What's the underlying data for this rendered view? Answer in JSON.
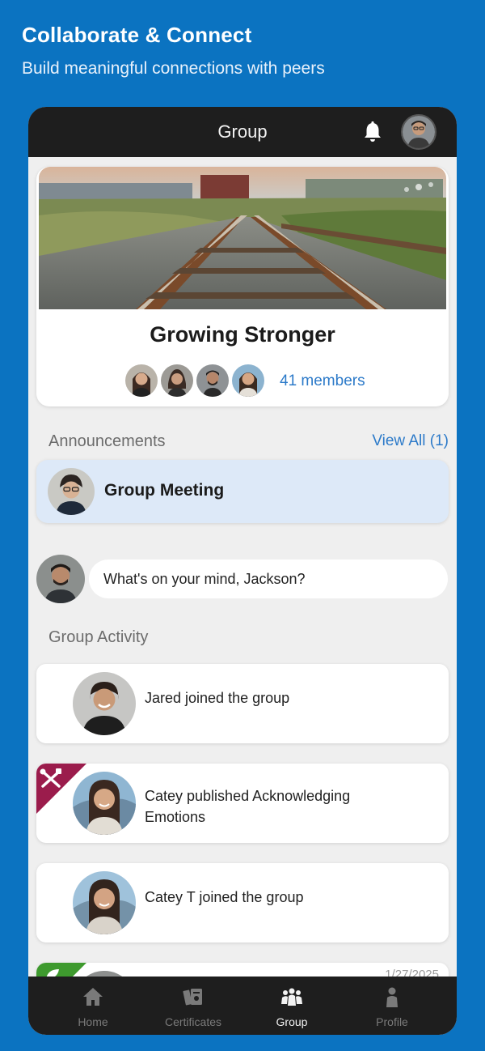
{
  "promo": {
    "title": "Collaborate & Connect",
    "subtitle": "Build meaningful connections with peers"
  },
  "header": {
    "title": "Group",
    "icons": [
      "bell-icon",
      "user-avatar"
    ]
  },
  "group": {
    "name": "Growing Stronger",
    "members_label": "41 members",
    "member_avatar_count": 4
  },
  "announcements": {
    "section_label": "Announcements",
    "view_all_label": "View All (1)",
    "items": [
      {
        "title": "Group Meeting"
      }
    ]
  },
  "composer": {
    "placeholder": "What's on your mind, Jackson?"
  },
  "activity": {
    "section_label": "Group Activity",
    "items": [
      {
        "text": "Jared joined the group",
        "badge": ""
      },
      {
        "text": "Catey published Acknowledging Emotions",
        "badge": "tools-icon"
      },
      {
        "text": "Catey T joined the group",
        "badge": ""
      },
      {
        "text": "",
        "badge": "leaf-icon",
        "date": "1/27/2025"
      }
    ]
  },
  "nav": {
    "items": [
      {
        "label": "Home",
        "icon": "home-icon",
        "active": false
      },
      {
        "label": "Certificates",
        "icon": "certificates-icon",
        "active": false
      },
      {
        "label": "Group",
        "icon": "group-icon",
        "active": true
      },
      {
        "label": "Profile",
        "icon": "profile-icon",
        "active": false
      }
    ]
  },
  "colors": {
    "brand_blue": "#0b73c1",
    "bar_dark": "#1e1e1e",
    "link_blue": "#2c7ac9",
    "announcement_bg": "#dde9f8",
    "badge_maroon": "#9b1c4c",
    "badge_green": "#3e9a2e"
  }
}
